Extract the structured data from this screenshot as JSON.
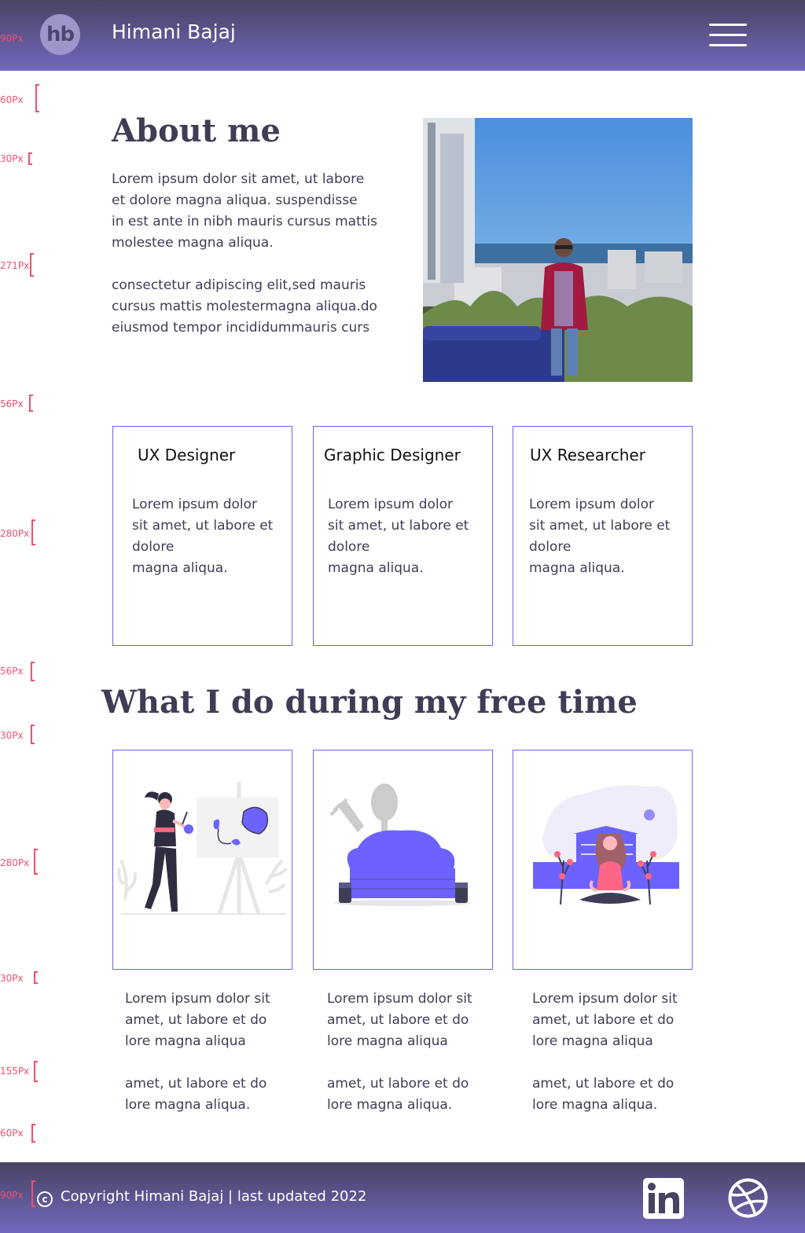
{
  "header": {
    "logo_text": "hb",
    "title": "Himani Bajaj",
    "menu_icon": "hamburger-menu-icon"
  },
  "spacing_marks": [
    "90Px",
    "60Px",
    "30Px",
    "271Px",
    "56Px",
    "280Px",
    "56Px",
    "30Px",
    "280Px",
    "30Px",
    "155Px",
    "60Px",
    "90Px"
  ],
  "about": {
    "title": "About me",
    "paragraph_1": "Lorem ipsum dolor sit amet, ut labore\net dolore magna aliqua. suspendisse\nin est ante in nibh mauris cursus mattis\n molestee magna aliqua.",
    "paragraph_2": "consectetur adipiscing elit,sed mauris\ncursus mattis molestermagna aliqua.do\n eiusmod tempor incididummauris curs"
  },
  "roles": [
    {
      "title": "UX Designer",
      "text": "Lorem ipsum dolor\nsit amet, ut labore  et\ndolore\n magna aliqua."
    },
    {
      "title": "Graphic Designer",
      "text": "Lorem ipsum dolor\nsit amet, ut labore  et\ndolore\n magna aliqua."
    },
    {
      "title": "UX Researcher",
      "text": "Lorem ipsum dolor\nsit amet, ut labore  et\ndolore\n magna aliqua."
    }
  ],
  "free_time": {
    "title": "What I do during my free time",
    "items": [
      {
        "illustration": "painting-illustration",
        "text": "Lorem ipsum dolor sit\namet, ut labore  et do\nlore magna aliqua\n\namet, ut labore  et do\nlore magna aliqua."
      },
      {
        "illustration": "cooking-illustration",
        "text": "Lorem ipsum dolor sit\namet, ut labore  et do\nlore magna aliqua\n\namet, ut labore  et do\nlore magna aliqua."
      },
      {
        "illustration": "meditation-illustration",
        "text": "Lorem ipsum dolor sit\namet, ut labore  et do\nlore magna aliqua\n\namet, ut labore  et do\nlore magna aliqua."
      }
    ]
  },
  "footer": {
    "copyright_symbol": "c",
    "copyright": "Copyright Himani Bajaj | last updated 2022",
    "social_icons": [
      "linkedin-icon",
      "dribbble-icon"
    ]
  },
  "colors": {
    "header_top": "#474462",
    "header_bottom": "#7168be",
    "accent": "#6c63ff",
    "heading": "#3f3d56",
    "annotation": "#f0506e"
  }
}
